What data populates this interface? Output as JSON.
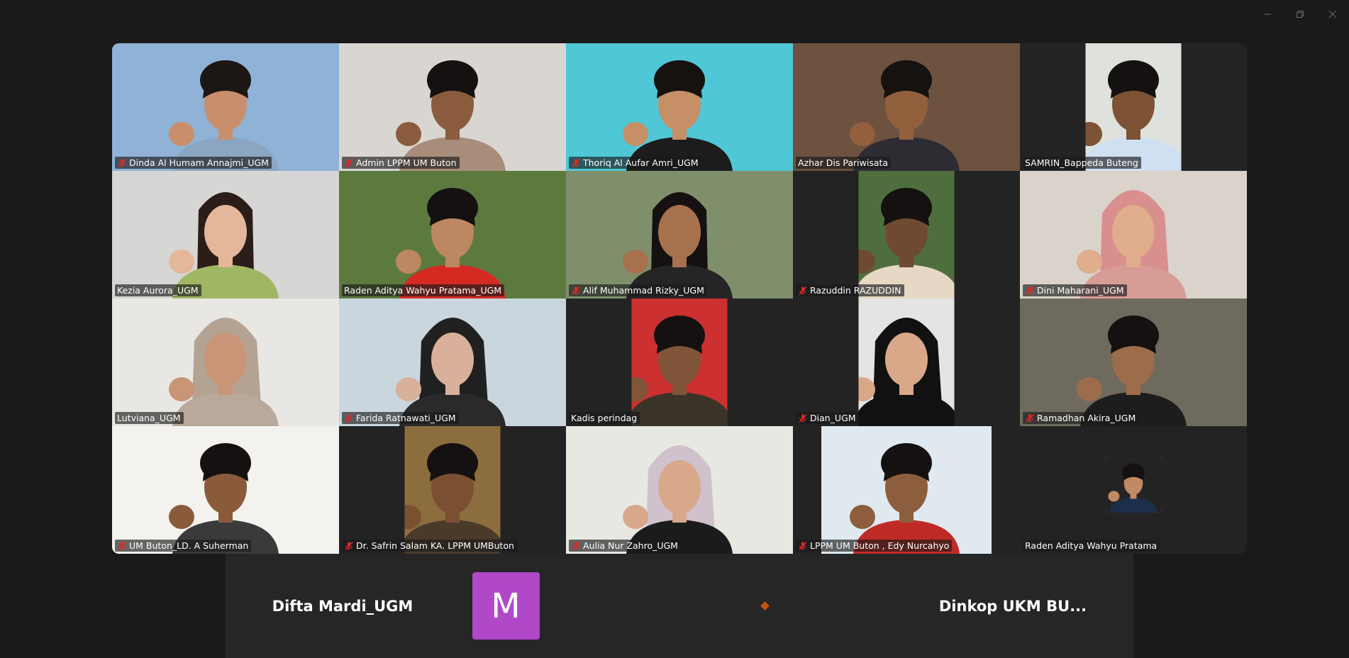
{
  "window": {
    "controls": [
      {
        "name": "minimize-button",
        "icon": "minimize-icon"
      },
      {
        "name": "restore-button",
        "icon": "restore-icon"
      },
      {
        "name": "close-button",
        "icon": "close-icon"
      }
    ]
  },
  "gallery": {
    "active_border_color": "#23d9a0",
    "muted_icon_color": "#e02828",
    "tiles": [
      {
        "name": "Dinda Al Humam Annajmi_UGM",
        "muted": true,
        "frame": "full",
        "bg": "#8fb2d6",
        "skin": "#c98f6c",
        "shirt": "#8aa6c2",
        "hair": "#1c1714",
        "style": "short"
      },
      {
        "name": "Admin LPPM UM Buton",
        "muted": true,
        "frame": "full",
        "bg": "#d9d6d2",
        "skin": "#8a5b3c",
        "shirt": "#a88d7a",
        "hair": "#141110",
        "style": "short"
      },
      {
        "name": "Thoriq Al Aufar Amri_UGM",
        "muted": true,
        "frame": "full",
        "bg": "#4fc7d6",
        "skin": "#c68f66",
        "shirt": "#1c1c1c",
        "hair": "#151210",
        "style": "short"
      },
      {
        "name": "Azhar Dis Pariwisata",
        "muted": false,
        "frame": "full",
        "bg": "#6d5240",
        "skin": "#93603e",
        "shirt": "#2e2c33",
        "hair": "#151210",
        "style": "short"
      },
      {
        "name": "SAMRIN_Bappeda Buteng",
        "muted": false,
        "frame": "narrow",
        "bg": "#dfe2dc",
        "skin": "#7d5235",
        "shirt": "#cfe0f3",
        "hair": "#141110",
        "style": "short"
      },
      {
        "name": "Kezia Aurora_UGM",
        "muted": false,
        "active": true,
        "frame": "full",
        "bg": "#d6d6d4",
        "skin": "#e5b79a",
        "shirt": "#9fb663",
        "hair": "#2b1d17",
        "style": "long"
      },
      {
        "name": "Raden Aditya Wahyu Pratama_UGM",
        "muted": false,
        "frame": "full",
        "bg": "#5c7a3e",
        "skin": "#bc8761",
        "shirt": "#d42a22",
        "hair": "#141110",
        "style": "short"
      },
      {
        "name": "Alif Muhammad Rizky_UGM",
        "muted": true,
        "frame": "full",
        "bg": "#7f8f6c",
        "skin": "#a7714d",
        "shirt": "#252525",
        "hair": "#141110",
        "style": "long"
      },
      {
        "name": "Razuddin RAZUDDIN",
        "muted": true,
        "frame": "narrow",
        "bg": "#4f6e3e",
        "skin": "#6e4a31",
        "shirt": "#e6d8c4",
        "hair": "#141110",
        "style": "short"
      },
      {
        "name": "Dini Maharani_UGM",
        "muted": true,
        "frame": "full",
        "bg": "#d9d3cc",
        "skin": "#e0ad8d",
        "shirt": "#d79c96",
        "hair": "#d98f8e",
        "style": "hijab"
      },
      {
        "name": "Lutviana_UGM",
        "muted": false,
        "frame": "full",
        "bg": "#e9e7e3",
        "skin": "#c99576",
        "shirt": "#b9a99a",
        "hair": "#b4a393",
        "style": "hijab"
      },
      {
        "name": "Farida Ratnawati_UGM",
        "muted": true,
        "frame": "full",
        "bg": "#c9d6dd",
        "skin": "#d9b09a",
        "shirt": "#2a2a2a",
        "hair": "#202020",
        "style": "hijab"
      },
      {
        "name": "Kadis perindag",
        "muted": false,
        "frame": "narrow",
        "bg": "#cc3030",
        "skin": "#80553a",
        "shirt": "#3a3428",
        "hair": "#141110",
        "style": "short"
      },
      {
        "name": "Dian_UGM",
        "muted": true,
        "frame": "narrow",
        "bg": "#e4e4e2",
        "skin": "#d9a889",
        "shirt": "#111111",
        "hair": "#111111",
        "style": "hijab"
      },
      {
        "name": "Ramadhan Akira_UGM",
        "muted": true,
        "frame": "full",
        "bg": "#6f6a5e",
        "skin": "#9d6c4b",
        "shirt": "#1d1d1d",
        "hair": "#141110",
        "style": "short"
      },
      {
        "name": "UM Buton_LD. A Suherman",
        "muted": true,
        "frame": "full",
        "bg": "#f4f2ee",
        "skin": "#8a5b3b",
        "shirt": "#3a3a3a",
        "hair": "#141110",
        "style": "short"
      },
      {
        "name": "Dr. Safrin Salam KA. LPPM UMButon",
        "muted": true,
        "frame": "narrow",
        "bg": "#8c6d3e",
        "skin": "#7a4f32",
        "shirt": "#4a3a2a",
        "hair": "#141110",
        "style": "short"
      },
      {
        "name": "Aulia Nur Zahro_UGM",
        "muted": true,
        "frame": "full",
        "bg": "#e7e8e2",
        "skin": "#d9a88a",
        "shirt": "#1b1b1b",
        "hair": "#cfc2cc",
        "style": "hijab"
      },
      {
        "name": "LPPM UM Buton , Edy Nurcahyo",
        "muted": true,
        "frame": "mid",
        "bg": "#dfe9ef",
        "skin": "#8d5e3d",
        "shirt": "#c02a26",
        "hair": "#141110",
        "style": "short"
      },
      {
        "name": "Raden Aditya Wahyu Pratama",
        "muted": false,
        "frame": "avatar",
        "bg": "#232323",
        "skin": "#c08a63",
        "shirt": "#1c2f4a",
        "hair": "#141110",
        "style": "short"
      }
    ]
  },
  "strip": {
    "left_name": "Difta Mardi_UGM",
    "avatar_letter": "M",
    "avatar_color": "#b048c8",
    "dot_color": "#c1530f",
    "right_name": "Dinkop  UKM  BU..."
  }
}
